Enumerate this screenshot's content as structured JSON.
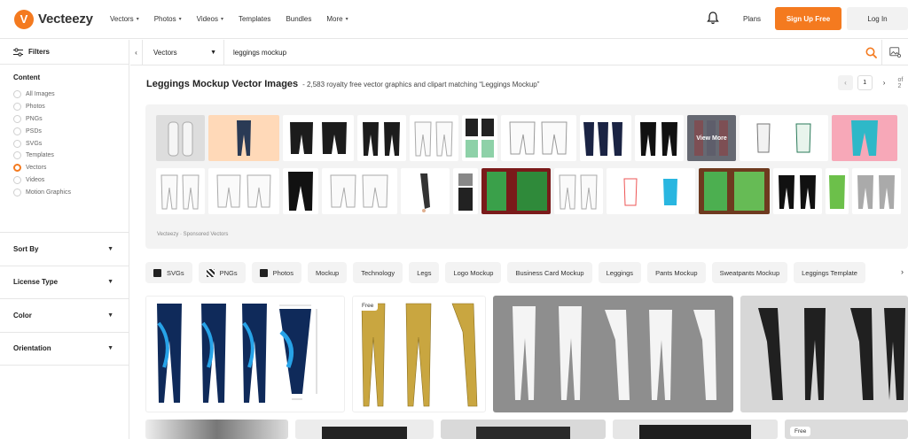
{
  "header": {
    "logo_mark": "V",
    "logo_text": "Vecteezy",
    "nav": [
      "Vectors",
      "Photos",
      "Videos",
      "Templates",
      "Bundles",
      "More"
    ],
    "nav_has_dropdown": [
      true,
      true,
      true,
      false,
      false,
      true
    ],
    "plans": "Plans",
    "signup": "Sign Up Free",
    "login": "Log In"
  },
  "sidebar": {
    "filters_label": "Filters",
    "content_title": "Content",
    "content_options": [
      "All Images",
      "Photos",
      "PNGs",
      "PSDs",
      "SVGs",
      "Templates",
      "Vectors",
      "Videos",
      "Motion Graphics"
    ],
    "content_selected": "Vectors",
    "collapsibles": [
      "Sort By",
      "License Type",
      "Color",
      "Orientation"
    ]
  },
  "search": {
    "type": "Vectors",
    "query": "leggings mockup"
  },
  "results_header": {
    "title": "Leggings Mockup Vector Images",
    "subtitle": "- 2,583 royalty free vector graphics and clipart matching “Leggings Mockup”",
    "page": "1",
    "of_label": "of 2"
  },
  "sponsored": {
    "label": "Vecteezy · Sponsored Vectors",
    "view_more": "View More"
  },
  "tags": [
    {
      "label": "SVGs",
      "icon": "svg-file-icon"
    },
    {
      "label": "PNGs",
      "icon": "png-file-icon"
    },
    {
      "label": "Photos",
      "icon": "photo-icon"
    },
    {
      "label": "Mockup"
    },
    {
      "label": "Technology"
    },
    {
      "label": "Legs"
    },
    {
      "label": "Logo Mockup"
    },
    {
      "label": "Business Card Mockup"
    },
    {
      "label": "Leggings"
    },
    {
      "label": "Pants Mockup"
    },
    {
      "label": "Sweatpants Mockup"
    },
    {
      "label": "Leggings Template"
    }
  ],
  "results": {
    "free_badge": "Free"
  },
  "colors": {
    "accent": "#f47a1f",
    "border": "#e6e6e6",
    "tag_bg": "#f3f3f3"
  }
}
